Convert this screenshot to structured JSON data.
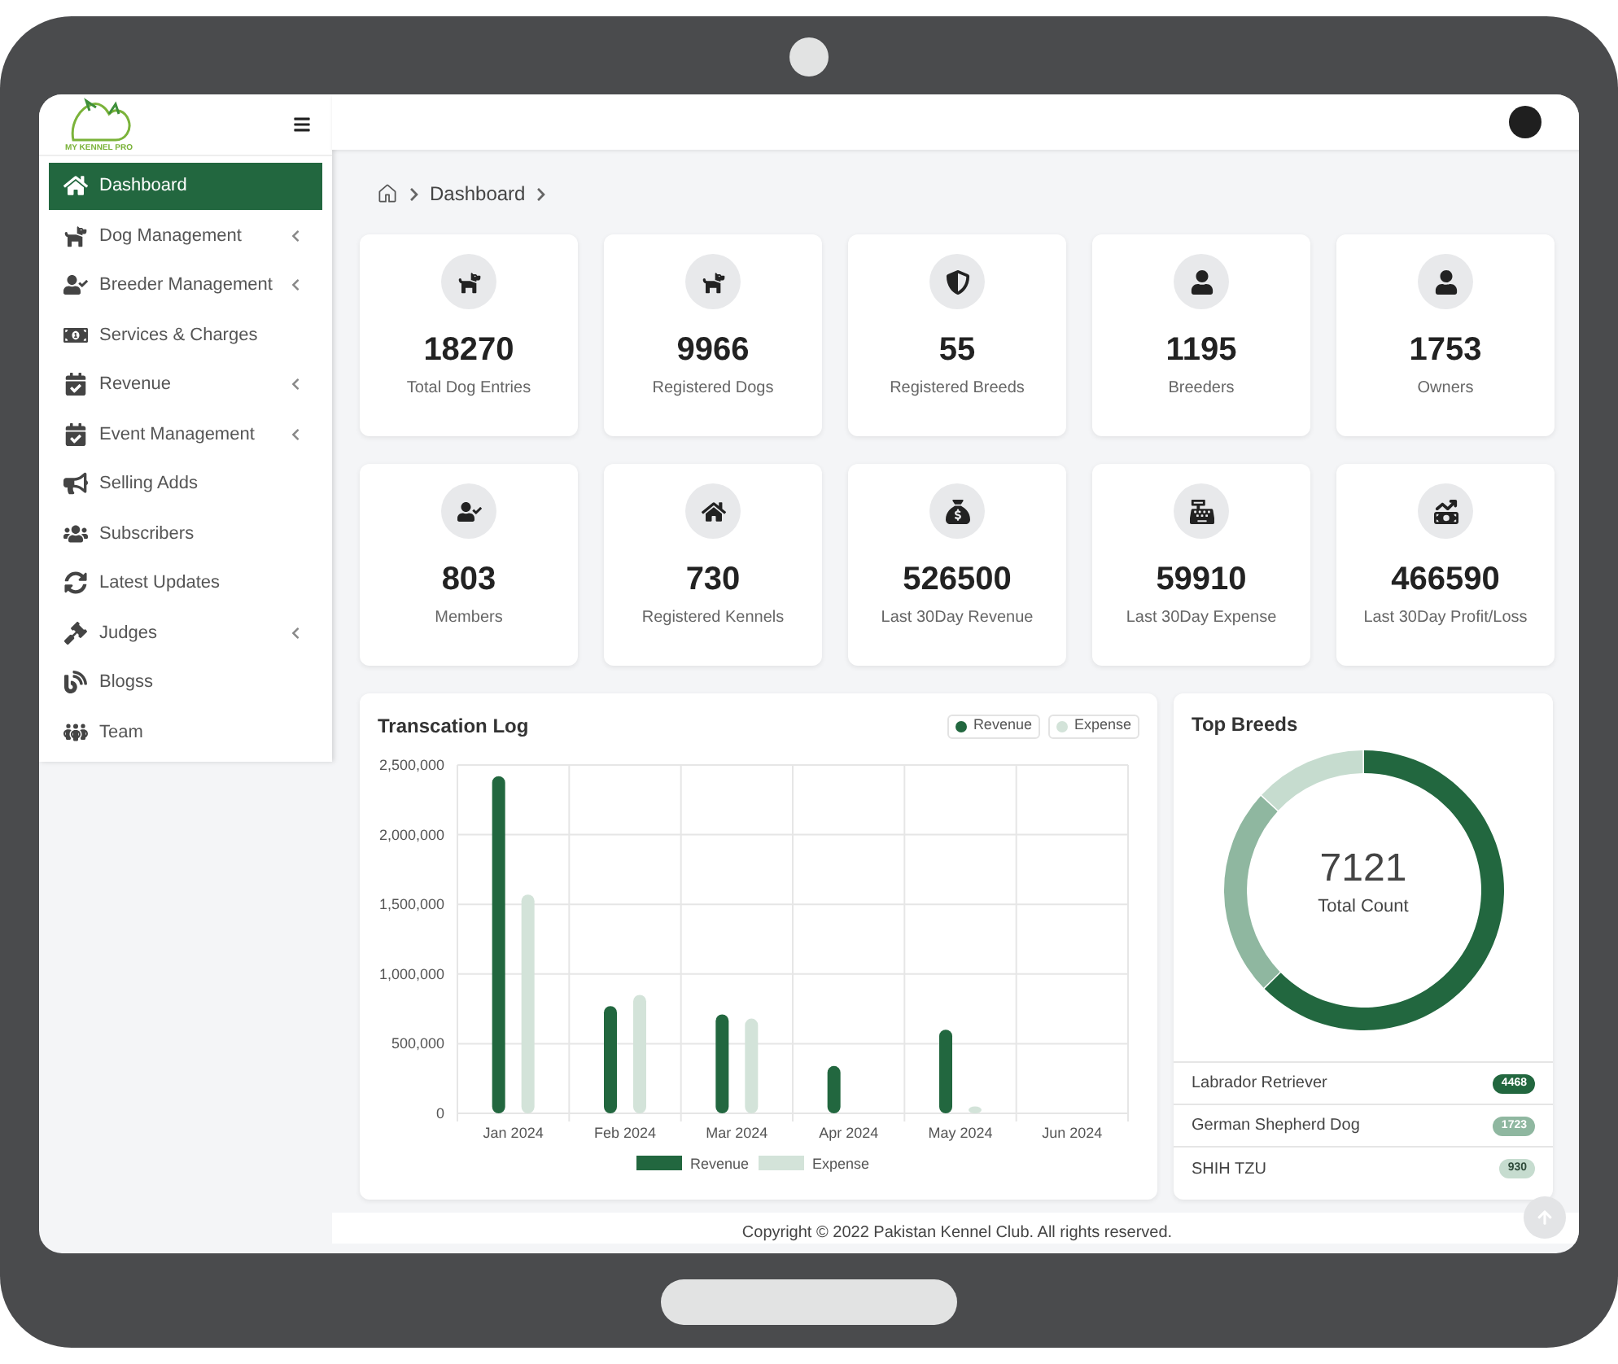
{
  "logo": {
    "text": "MY KENNEL PRO"
  },
  "sidebar": {
    "items": [
      {
        "label": "Dashboard",
        "selected": true,
        "expandable": false
      },
      {
        "label": "Dog Management",
        "selected": false,
        "expandable": true
      },
      {
        "label": "Breeder Management",
        "selected": false,
        "expandable": true
      },
      {
        "label": "Services & Charges",
        "selected": false,
        "expandable": false
      },
      {
        "label": "Revenue",
        "selected": false,
        "expandable": true
      },
      {
        "label": "Event Management",
        "selected": false,
        "expandable": true
      },
      {
        "label": "Selling Adds",
        "selected": false,
        "expandable": false
      },
      {
        "label": "Subscribers",
        "selected": false,
        "expandable": false
      },
      {
        "label": "Latest Updates",
        "selected": false,
        "expandable": false
      },
      {
        "label": "Judges",
        "selected": false,
        "expandable": true
      },
      {
        "label": "Blogss",
        "selected": false,
        "expandable": false
      },
      {
        "label": "Team",
        "selected": false,
        "expandable": false
      }
    ]
  },
  "breadcrumb": [
    "Dashboard"
  ],
  "stats": [
    {
      "value": "18270",
      "label": "Total Dog Entries"
    },
    {
      "value": "9966",
      "label": "Registered Dogs"
    },
    {
      "value": "55",
      "label": "Registered Breeds"
    },
    {
      "value": "1195",
      "label": "Breeders"
    },
    {
      "value": "1753",
      "label": "Owners"
    },
    {
      "value": "803",
      "label": "Members"
    },
    {
      "value": "730",
      "label": "Registered Kennels"
    },
    {
      "value": "526500",
      "label": "Last 30Day Revenue"
    },
    {
      "value": "59910",
      "label": "Last 30Day Expense"
    },
    {
      "value": "466590",
      "label": "Last 30Day Profit/Loss"
    }
  ],
  "transaction_log": {
    "title": "Transcation Log",
    "legend_chips": [
      "Revenue",
      "Expense"
    ],
    "chart_data": {
      "type": "bar",
      "categories": [
        "Jan 2024",
        "Feb 2024",
        "Mar 2024",
        "Apr 2024",
        "May 2024",
        "Jun 2024"
      ],
      "series": [
        {
          "name": "Revenue",
          "color": "#22673f",
          "values": [
            2420000,
            770000,
            710000,
            340000,
            600000,
            0
          ]
        },
        {
          "name": "Expense",
          "color": "#d3e3d9",
          "values": [
            1570000,
            850000,
            680000,
            0,
            50000,
            0
          ]
        }
      ],
      "grid": true,
      "legend": true,
      "ylim": [
        0,
        2500000
      ],
      "yticks": [
        {
          "value": 0,
          "label": "0"
        },
        {
          "value": 500000,
          "label": "500,000"
        },
        {
          "value": 1000000,
          "label": "1,000,000"
        },
        {
          "value": 1500000,
          "label": "1,500,000"
        },
        {
          "value": 2000000,
          "label": "2,000,000"
        },
        {
          "value": 2500000,
          "label": "2,500,000"
        }
      ]
    }
  },
  "top_breeds": {
    "title": "Top Breeds",
    "total": "7121",
    "total_label": "Total Count",
    "chart_data": {
      "type": "donut",
      "values": [
        62.74,
        24.2,
        13.06
      ]
    },
    "items": [
      {
        "name": "Labrador Retriever",
        "count": "4468",
        "color": "#22673f"
      },
      {
        "name": "German Shepherd Dog",
        "count": "1723",
        "color": "#8fb7a0"
      },
      {
        "name": "SHIH TZU",
        "count": "930",
        "color": "#c6dccf"
      }
    ]
  },
  "footer": {
    "text": "Copyright © 2022 Pakistan Kennel Club. All rights reserved."
  }
}
